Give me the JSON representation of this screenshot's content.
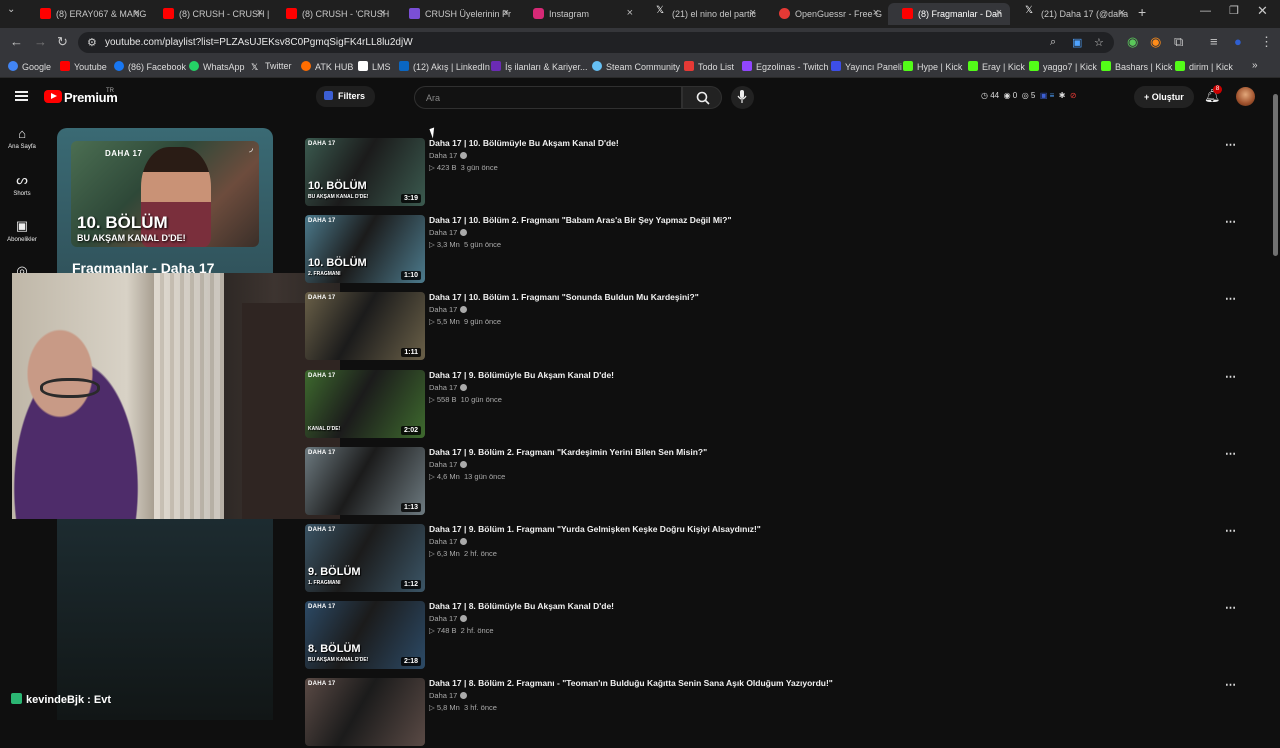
{
  "browser": {
    "tabs": [
      {
        "title": "(8) ERAY067 & MANG",
        "icon": "youtube-icon",
        "color": "#ff0000"
      },
      {
        "title": "(8) CRUSH - CRUSH |",
        "icon": "youtube-icon",
        "color": "#ff0000"
      },
      {
        "title": "(8) CRUSH - 'CRUSH",
        "icon": "youtube-icon",
        "color": "#ff0000"
      },
      {
        "title": "CRUSH Üyelerinin Pr",
        "icon": "kick-k-icon",
        "color": "#7a4fd6"
      },
      {
        "title": "Instagram",
        "icon": "instagram-icon",
        "color": "#d62976"
      },
      {
        "title": "(21) el nino del partic",
        "icon": "x-icon",
        "color": "#ffffff"
      },
      {
        "title": "OpenGuessr - Free G",
        "icon": "openguessr-icon",
        "color": "#e53935"
      },
      {
        "title": "(8) Fragmanlar - Dah",
        "icon": "youtube-icon",
        "color": "#ff0000",
        "active": true
      },
      {
        "title": "(21) Daha 17 (@daha",
        "icon": "x-icon",
        "color": "#ffffff"
      }
    ],
    "new_tab": "+",
    "url": "youtube.com/playlist?list=PLZAsUJEKsv8C0PgmqSigFK4rLL8lu2djW",
    "bookmarks": [
      {
        "label": "Google",
        "color": "#4285f4"
      },
      {
        "label": "Youtube",
        "color": "#ff0000"
      },
      {
        "label": "(86) Facebook",
        "color": "#1877f2"
      },
      {
        "label": "WhatsApp",
        "color": "#25d366"
      },
      {
        "label": "Twitter",
        "color": "#ffffff"
      },
      {
        "label": "ATK HUB",
        "color": "#ff6d00"
      },
      {
        "label": "LMS",
        "color": "#ffffff"
      },
      {
        "label": "(12) Akış | LinkedIn",
        "color": "#0a66c2"
      },
      {
        "label": "İş ilanları & Kariyer...",
        "color": "#6b2bb5"
      },
      {
        "label": "Steam Community",
        "color": "#66c0f4"
      },
      {
        "label": "Todo List",
        "color": "#e53935"
      },
      {
        "label": "Egzolinas - Twitch",
        "color": "#9146ff"
      },
      {
        "label": "Yayıncı Paneli",
        "color": "#3d4ee8"
      },
      {
        "label": "Hype | Kick",
        "color": "#53fc18"
      },
      {
        "label": "Eray | Kick",
        "color": "#53fc18"
      },
      {
        "label": "yaggo7 | Kick",
        "color": "#53fc18"
      },
      {
        "label": "Bashars | Kick",
        "color": "#53fc18"
      },
      {
        "label": "dirim | Kick",
        "color": "#53fc18"
      }
    ]
  },
  "youtube": {
    "brand": "Premium",
    "region": "TR",
    "filters_label": "Filters",
    "search_placeholder": "Ara",
    "stats": {
      "views": "44",
      "likes": "0",
      "comments": "5"
    },
    "create_label": "Oluştur",
    "notification_count": "8",
    "guide": [
      {
        "label": "Ana Sayfa",
        "icon": "home-icon"
      },
      {
        "label": "Shorts",
        "icon": "shorts-icon"
      },
      {
        "label": "Abonelikler",
        "icon": "subscriptions-icon"
      }
    ]
  },
  "playlist": {
    "title": "Fragmanlar - Daha 17",
    "thumb_brand": "DAHA 17",
    "thumb_big": "10. BÖLÜM",
    "thumb_small": "BU AKŞAM KANAL D'DE!"
  },
  "videos": [
    {
      "title": "Daha 17 | 10. Bölümüyle Bu Akşam Kanal D'de!",
      "channel": "Daha 17",
      "views": "423 B",
      "age": "3 gün önce",
      "duration": "3:19",
      "thumb_big": "10. BÖLÜM",
      "thumb_small": "BU AKŞAM KANAL D'DE!",
      "thumb_color": "#3b5a4f"
    },
    {
      "title": "Daha 17 | 10. Bölüm 2. Fragmanı \"Babam Aras'a Bir Şey Yapmaz Değil Mi?\"",
      "channel": "Daha 17",
      "views": "3,3 Mn",
      "age": "5 gün önce",
      "duration": "1:10",
      "thumb_big": "10. BÖLÜM",
      "thumb_small": "2. FRAGMANI",
      "thumb_color": "#4c7a8c"
    },
    {
      "title": "Daha 17 | 10. Bölüm 1. Fragmanı \"Sonunda Buldun Mu Kardeşini?\"",
      "channel": "Daha 17",
      "views": "5,5 Mn",
      "age": "9 gün önce",
      "duration": "1:11",
      "thumb_big": "",
      "thumb_small": "",
      "thumb_color": "#6a6048"
    },
    {
      "title": "Daha 17 | 9. Bölümüyle Bu Akşam Kanal D'de!",
      "channel": "Daha 17",
      "views": "558 B",
      "age": "10 gün önce",
      "duration": "2:02",
      "thumb_big": "",
      "thumb_small": "KANAL D'DE!",
      "thumb_color": "#3e6a2e"
    },
    {
      "title": "Daha 17 | 9. Bölüm 2. Fragmanı \"Kardeşimin Yerini Bilen Sen Misin?\"",
      "channel": "Daha 17",
      "views": "4,6 Mn",
      "age": "13 gün önce",
      "duration": "1:13",
      "thumb_big": "",
      "thumb_small": "",
      "thumb_color": "#6d7a80"
    },
    {
      "title": "Daha 17 | 9. Bölüm 1. Fragmanı \"Yurda Gelmişken Keşke Doğru Kişiyi Alsaydınız!\"",
      "channel": "Daha 17",
      "views": "6,3 Mn",
      "age": "2 hf. önce",
      "duration": "1:12",
      "thumb_big": "9. BÖLÜM",
      "thumb_small": "1. FRAGMANI",
      "thumb_color": "#3b5566"
    },
    {
      "title": "Daha 17 | 8. Bölümüyle Bu Akşam Kanal D'de!",
      "channel": "Daha 17",
      "views": "748 B",
      "age": "2 hf. önce",
      "duration": "2:18",
      "thumb_big": "8. BÖLÜM",
      "thumb_small": "BU AKŞAM KANAL D'DE!",
      "thumb_color": "#2c4a66"
    },
    {
      "title": "Daha 17 | 8. Bölüm 2. Fragmanı - \"Teoman'ın Bulduğu Kağıtta Senin Sana Aşık Olduğum Yazıyordu!\"",
      "channel": "Daha 17",
      "views": "5,8 Mn",
      "age": "3 hf. önce",
      "duration": "",
      "thumb_big": "",
      "thumb_small": "",
      "thumb_color": "#5a4a45"
    }
  ],
  "chat": {
    "user": "kevindeBjk",
    "message": "Evt",
    "separator": " : "
  }
}
